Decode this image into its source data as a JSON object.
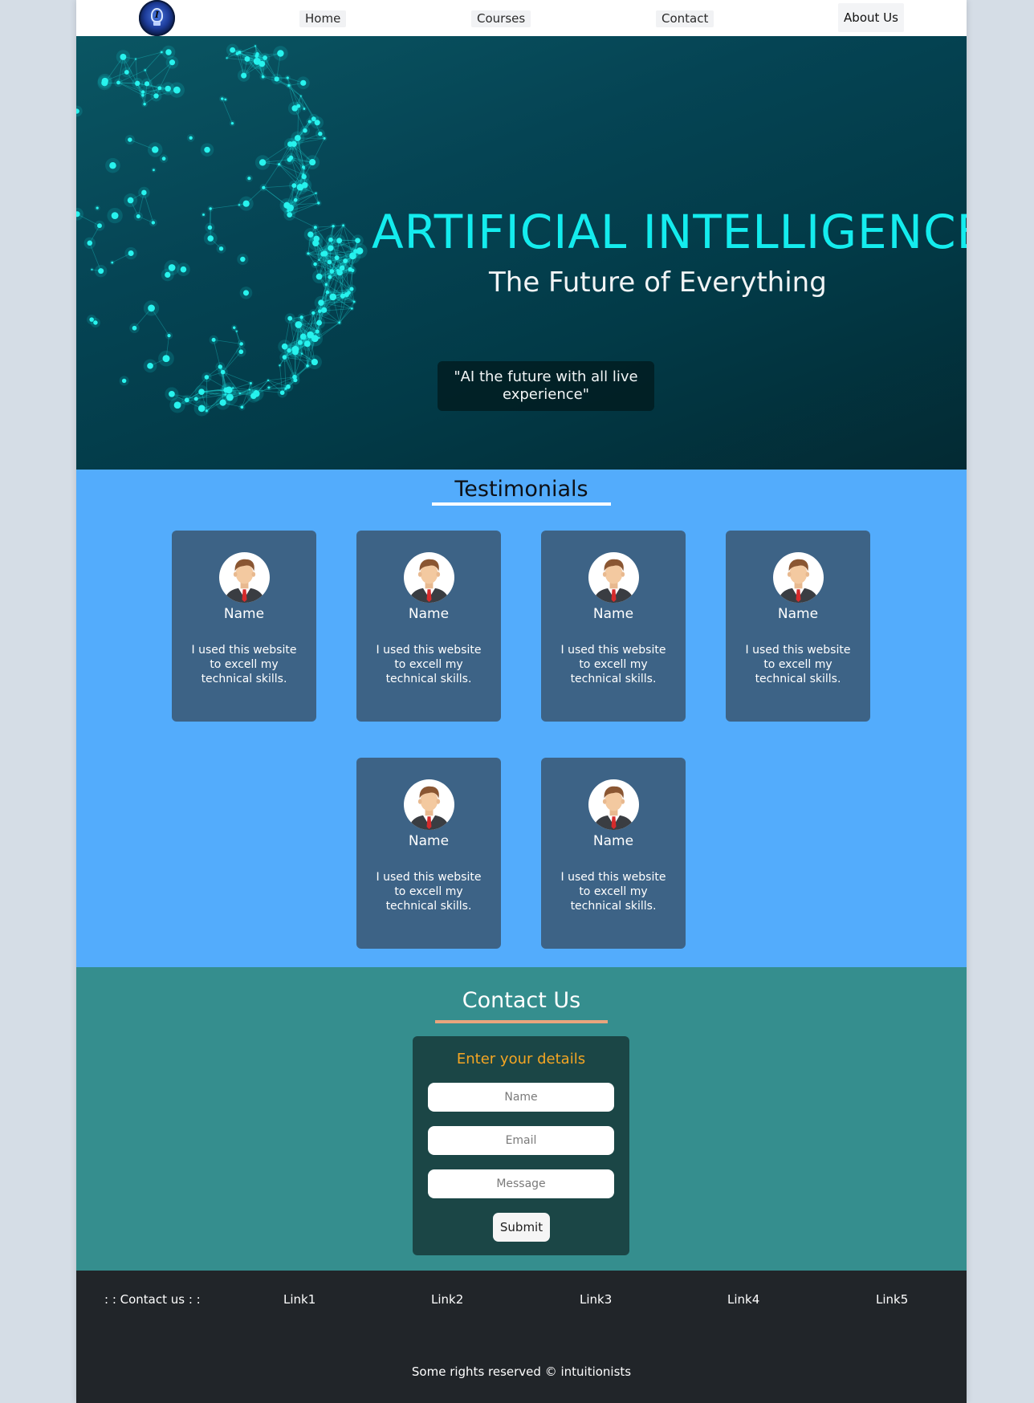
{
  "nav": {
    "logo_letter": "I",
    "links": [
      "Home",
      "Courses",
      "Contact"
    ],
    "about": "About Us"
  },
  "hero": {
    "title": "ARTIFICIAL INTELLIGENCE",
    "subtitle": "The Future of Everything",
    "quote": "\"AI the future with all live experience\""
  },
  "testimonials": {
    "heading": "Testimonials",
    "cards": [
      {
        "name": "Name",
        "text": "I used this website to excell my technical skills."
      },
      {
        "name": "Name",
        "text": "I used this website to excell my technical skills."
      },
      {
        "name": "Name",
        "text": "I used this website to excell my technical skills."
      },
      {
        "name": "Name",
        "text": "I used this website to excell my technical skills."
      },
      {
        "name": "Name",
        "text": "I used this website to excell my technical skills."
      },
      {
        "name": "Name",
        "text": "I used this website to excell my technical skills."
      }
    ]
  },
  "contact": {
    "heading": "Contact Us",
    "form_title": "Enter your details",
    "name_placeholder": "Name",
    "email_placeholder": "Email",
    "message_placeholder": "Message",
    "submit": "Submit"
  },
  "footer": {
    "contact_label": ": : Contact us : :",
    "links": [
      "Link1",
      "Link2",
      "Link3",
      "Link4",
      "Link5"
    ],
    "copyright": "Some rights reserved © intuitionists"
  },
  "colors": {
    "hero_title": "#14ecee",
    "testimonials_bg": "#53acfc",
    "card_bg": "#3d6386",
    "contact_bg": "#358e8e",
    "form_bg": "#1b4646",
    "form_title": "#f5a623",
    "footer_bg": "#212529"
  }
}
